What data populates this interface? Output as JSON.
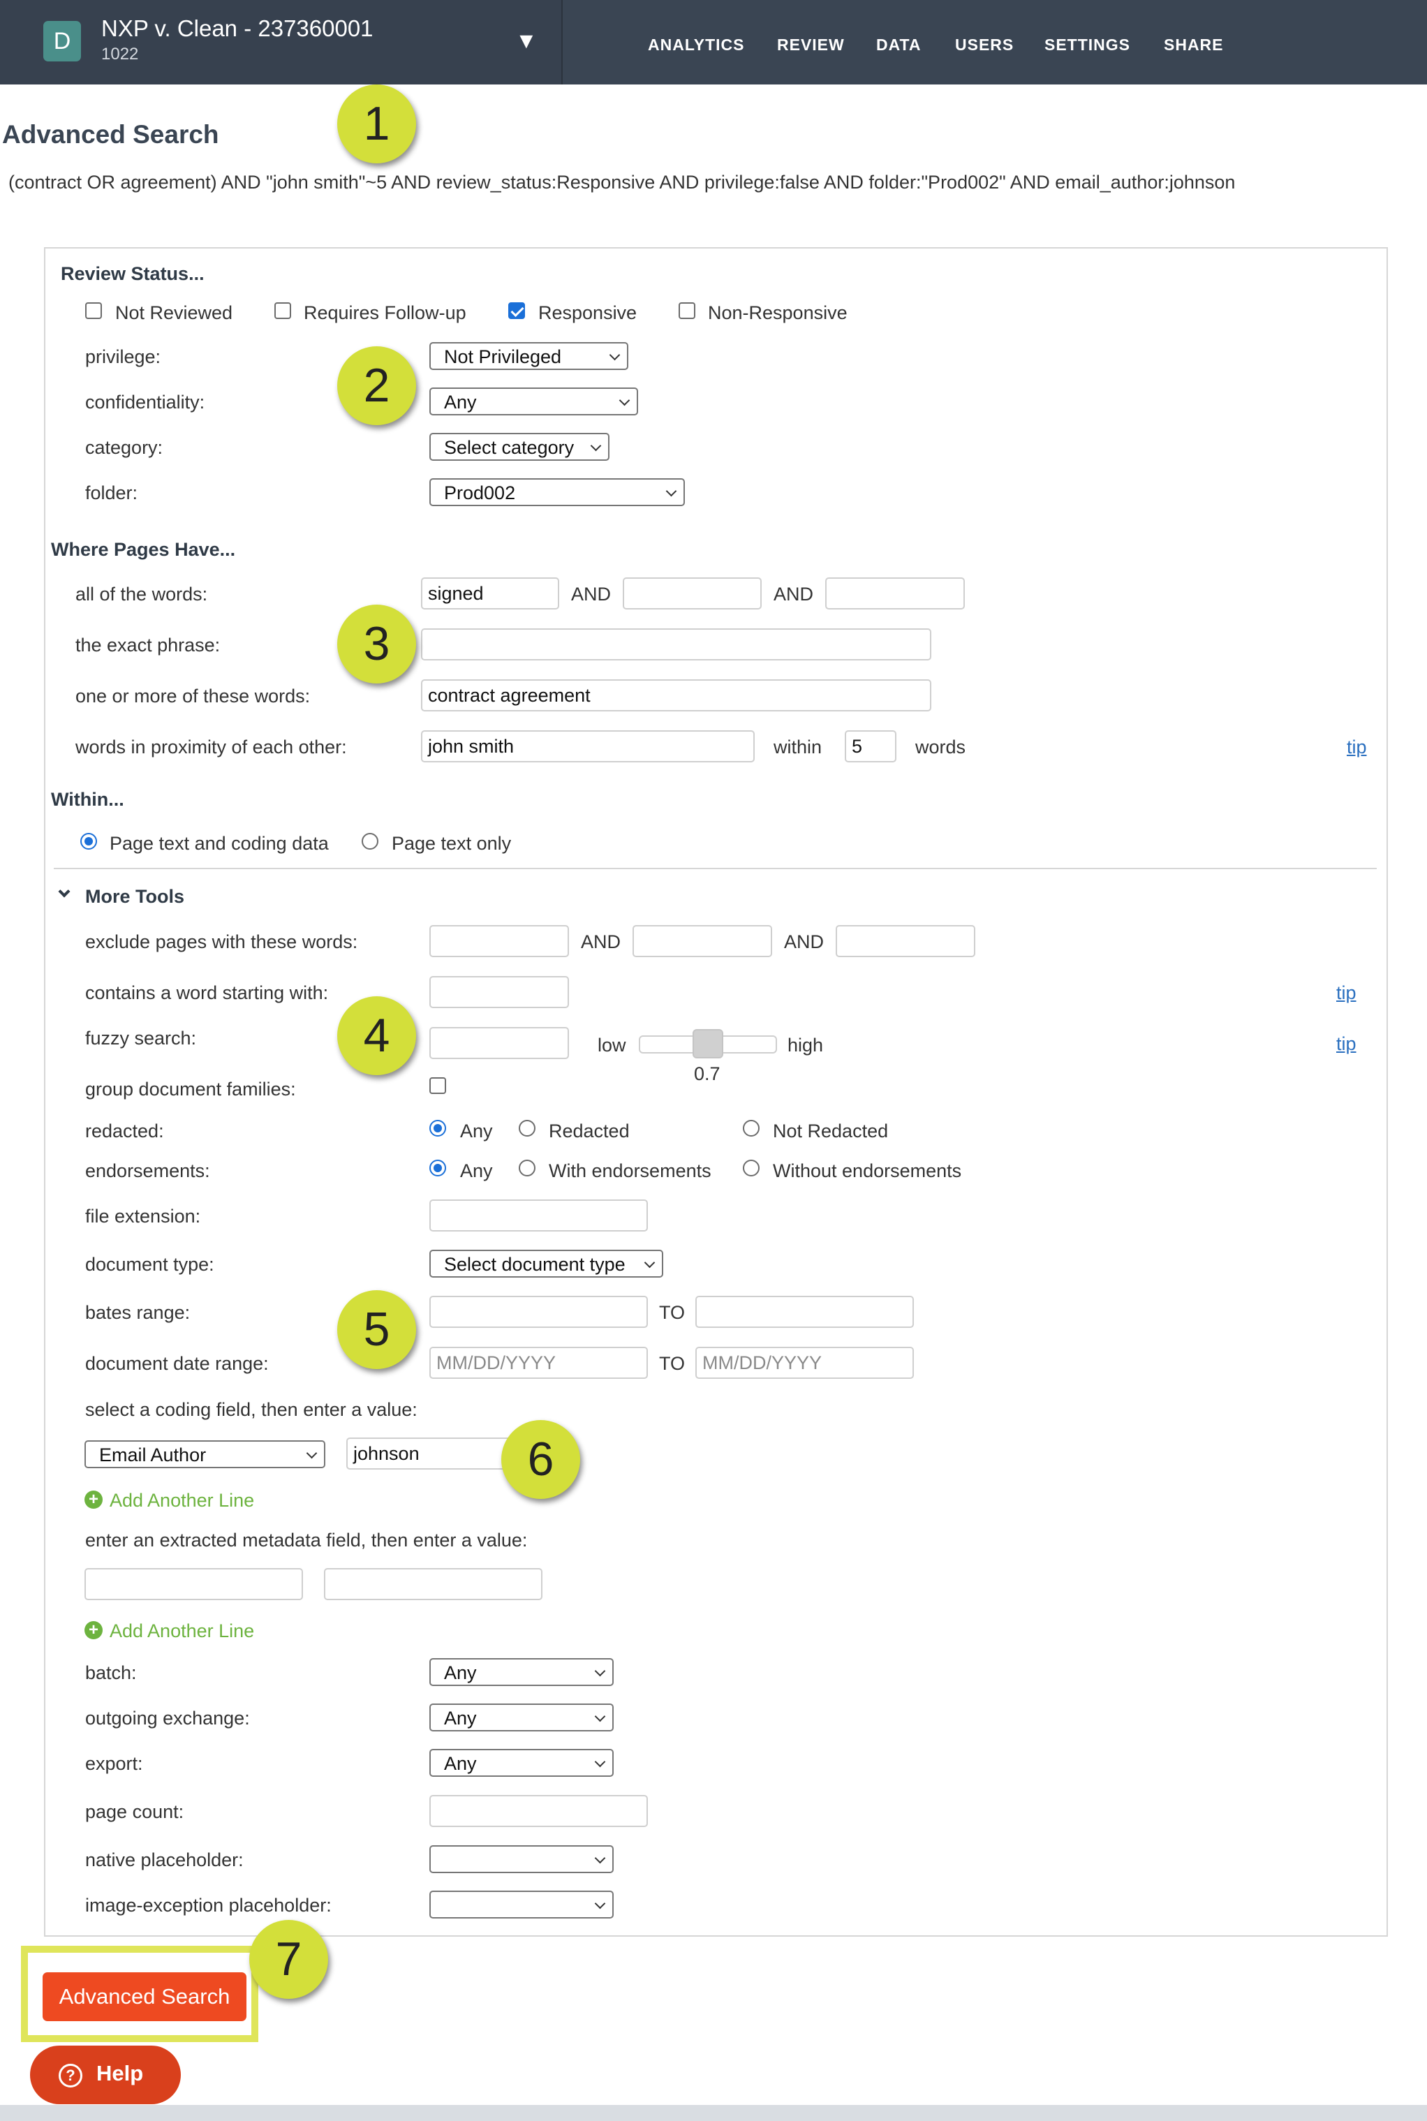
{
  "header": {
    "avatar_letter": "D",
    "project_title": "NXP v. Clean - 237360001",
    "project_sub": "1022",
    "caret": "▼",
    "nav": [
      "ANALYTICS",
      "REVIEW",
      "DATA",
      "USERS",
      "SETTINGS",
      "SHARE"
    ]
  },
  "page": {
    "title": "Advanced Search",
    "query": "(contract OR agreement) AND \"john smith\"~5 AND review_status:Responsive AND privilege:false AND folder:\"Prod002\" AND email_author:johnson"
  },
  "review_status": {
    "heading": "Review Status...",
    "checkboxes": [
      {
        "label": "Not Reviewed",
        "checked": false
      },
      {
        "label": "Requires Follow-up",
        "checked": false
      },
      {
        "label": "Responsive",
        "checked": true
      },
      {
        "label": "Non-Responsive",
        "checked": false
      }
    ],
    "privilege_label": "privilege:",
    "privilege_value": "Not Privileged",
    "confidentiality_label": "confidentiality:",
    "confidentiality_value": "Any",
    "category_label": "category:",
    "category_value": "Select category",
    "folder_label": "folder:",
    "folder_value": "Prod002"
  },
  "where": {
    "heading": "Where Pages Have...",
    "all_words_label": "all of the words:",
    "all_words": [
      "signed",
      "",
      ""
    ],
    "and": "AND",
    "exact_phrase_label": "the exact phrase:",
    "exact_phrase": "",
    "one_or_more_label": "one or more of these words:",
    "one_or_more": "contract agreement",
    "proximity_label": "words in proximity of each other:",
    "proximity": "john smith",
    "within": "within",
    "within_value": "5",
    "words": "words",
    "tip": "tip"
  },
  "within_section": {
    "heading": "Within...",
    "options": [
      {
        "label": "Page text and coding data",
        "checked": true
      },
      {
        "label": "Page text only",
        "checked": false
      }
    ]
  },
  "more_tools": {
    "heading": "More Tools",
    "exclude_label": "exclude pages with these words:",
    "starting_label": "contains a word starting with:",
    "fuzzy_label": "fuzzy search:",
    "fuzzy_low": "low",
    "fuzzy_high": "high",
    "fuzzy_value": "0.7",
    "group_label": "group document families:",
    "redacted_label": "redacted:",
    "redacted_options": [
      "Any",
      "Redacted",
      "Not Redacted"
    ],
    "endorsements_label": "endorsements:",
    "endorsements_options": [
      "Any",
      "With endorsements",
      "Without endorsements"
    ],
    "file_ext_label": "file extension:",
    "doc_type_label": "document type:",
    "doc_type_value": "Select document type",
    "bates_label": "bates range:",
    "to": "TO",
    "date_label": "document date range:",
    "date_placeholder": "MM/DD/YYYY",
    "coding_label": "select a coding field, then enter a value:",
    "coding_field": "Email Author",
    "coding_value": "johnson",
    "add_line": "Add Another Line",
    "metadata_label": "enter an extracted metadata field, then enter a value:",
    "batch_label": "batch:",
    "batch_value": "Any",
    "outgoing_label": "outgoing exchange:",
    "outgoing_value": "Any",
    "export_label": "export:",
    "export_value": "Any",
    "page_count_label": "page count:",
    "native_label": "native placeholder:",
    "native_value": "",
    "image_exc_label": "image-exception placeholder:",
    "image_exc_value": ""
  },
  "markers": [
    "1",
    "2",
    "3",
    "4",
    "5",
    "6",
    "7"
  ],
  "actions": {
    "search": "Advanced Search",
    "help": "Help",
    "help_icon": "?"
  },
  "colors": {
    "nav_bg": "#3a4553",
    "accent_button": "#ee4a21",
    "marker": "#d3df3a",
    "link_green": "#6db33f"
  }
}
